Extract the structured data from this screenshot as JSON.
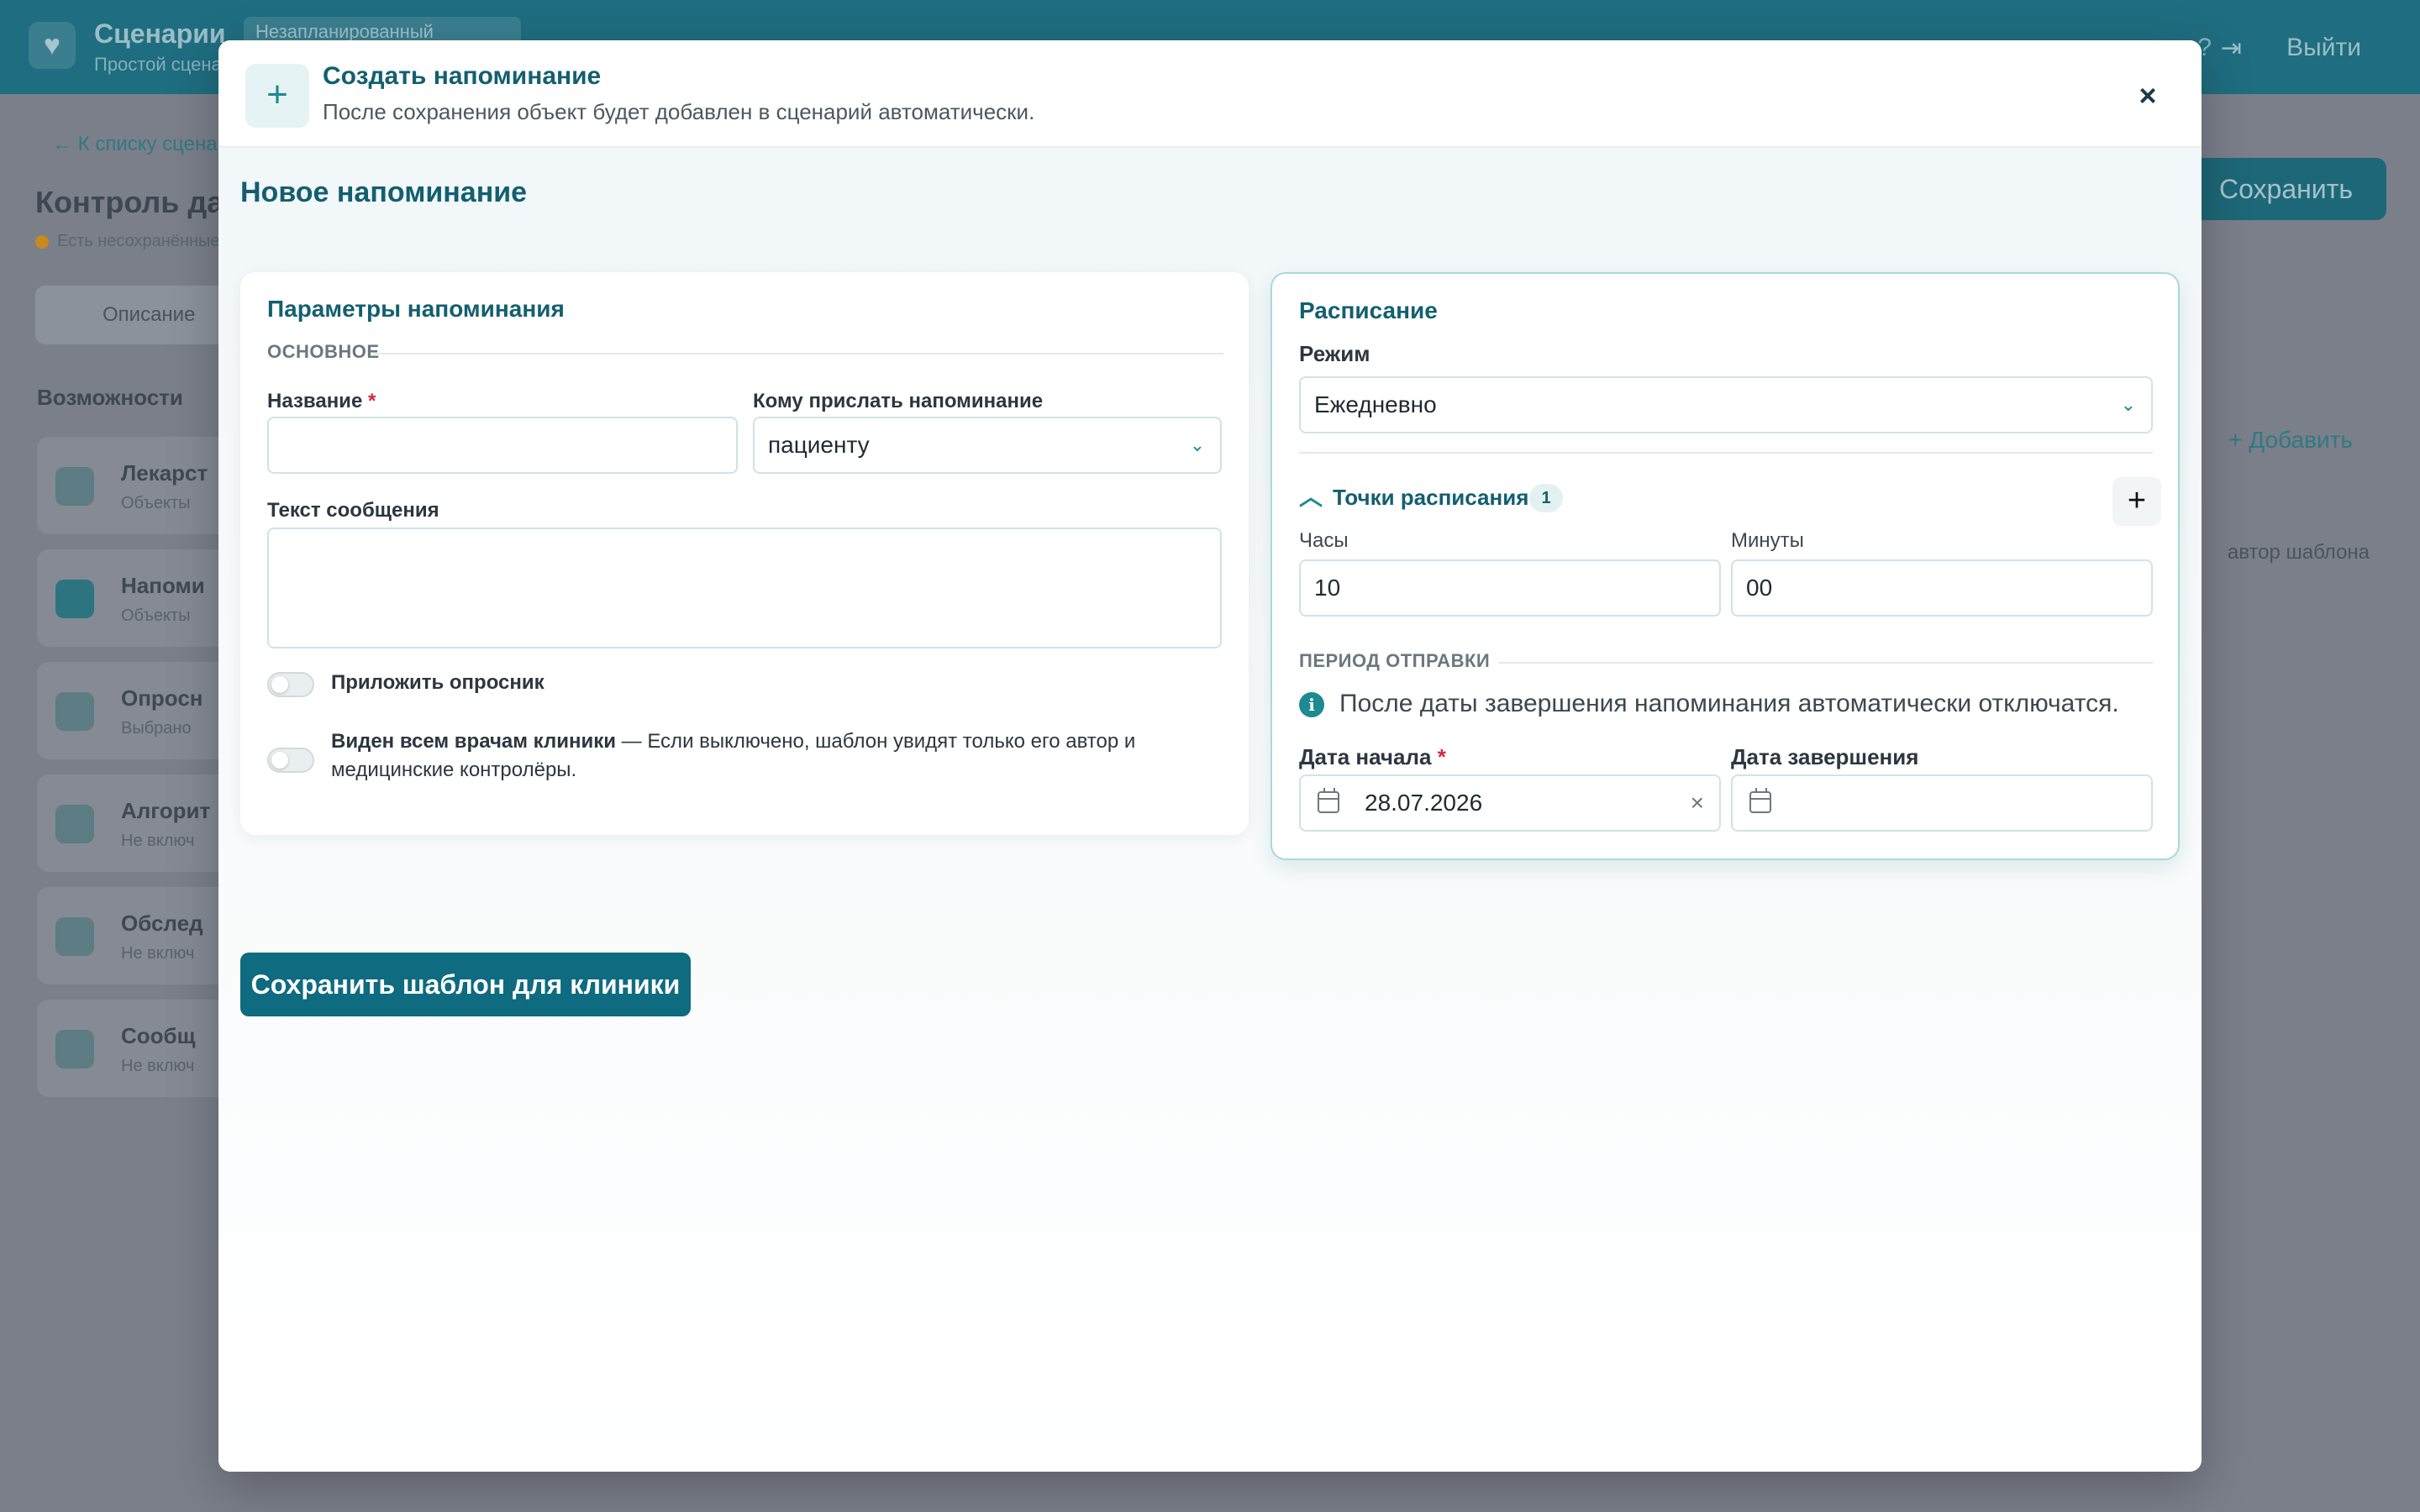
{
  "background": {
    "app_title": "Сценарии",
    "app_subtitle": "Простой сценарий",
    "chip": "Незапланированный",
    "logout": "Выйти",
    "back_link": "← К списку сценариев",
    "page_title": "Контроль дав",
    "warning": "Есть несохранённые изменения",
    "tab": "Описание",
    "section": "Возможности",
    "list_items": [
      {
        "name": "Лекарст",
        "sub": "Объекты"
      },
      {
        "name": "Напоми",
        "sub": "Объекты"
      },
      {
        "name": "Опросн",
        "sub": "Выбрано"
      },
      {
        "name": "Алгорит",
        "sub": "Не включ"
      },
      {
        "name": "Обслед",
        "sub": "Не включ"
      },
      {
        "name": "Сообщ",
        "sub": "Не включ"
      }
    ],
    "save_button": "Сохранить",
    "add_button": "+ Добавить",
    "author_filter": "автор шаблона"
  },
  "modal": {
    "header_icon": "plus-icon",
    "title": "Создать напоминание",
    "subtitle": "После сохранения объект будет добавлен в сценарий автоматически.",
    "close_label": "×",
    "section_title": "Новое напоминание",
    "params": {
      "title": "Параметры напоминания",
      "group_label": "ОСНОВНОЕ",
      "name_label": "Название",
      "required_mark": "*",
      "name_value": "",
      "recipient_label": "Кому прислать напоминание",
      "recipient_value": "пациенту",
      "message_label": "Текст сообщения",
      "message_value": "",
      "attach_survey_label": "Приложить опросник",
      "attach_survey_on": false,
      "visible_label": "Виден всем врачам клиники",
      "visible_hint": " — Если выключено, шаблон увидят только его автор и медицинские контролёры.",
      "visible_on": false
    },
    "schedule": {
      "title": "Расписание",
      "mode_label": "Режим",
      "mode_value": "Ежедневно",
      "points_title": "Точки расписания",
      "points_count": "1",
      "add_point": "+",
      "hours_label": "Часы",
      "hours_value": "10",
      "minutes_label": "Минуты",
      "minutes_value": "00",
      "period_label": "ПЕРИОД ОТПРАВКИ",
      "info_icon": "i",
      "info_text": "После даты завершения напоминания автоматически отключатся.",
      "start_label": "Дата начала",
      "required_mark": "*",
      "start_value": "28.07.2026",
      "end_label": "Дата завершения",
      "end_value": ""
    },
    "save_button": "Сохранить шаблон для клиники"
  },
  "colors": {
    "primary": "#0e6b80",
    "accent": "#1d8a91",
    "title": "#135f70",
    "required": "#d2293a",
    "overlay": "#7b7f8a"
  }
}
